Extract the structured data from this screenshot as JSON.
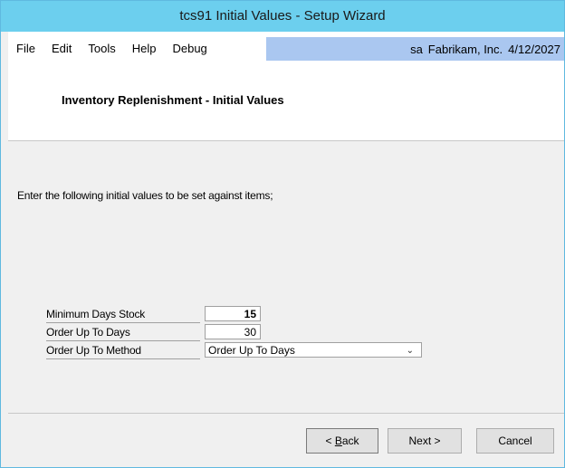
{
  "window": {
    "title": "tcs91 Initial Values - Setup Wizard"
  },
  "menu": {
    "items": [
      "File",
      "Edit",
      "Tools",
      "Help",
      "Debug"
    ]
  },
  "status": {
    "user": "sa",
    "company": "Fabrikam, Inc.",
    "date": "4/12/2027"
  },
  "header": {
    "title": "Inventory Replenishment - Initial Values"
  },
  "body": {
    "instruction": "Enter the following initial values to be set against items;",
    "fields": [
      {
        "label": "Minimum Days Stock",
        "value": "15"
      },
      {
        "label": "Order Up To Days",
        "value": "30"
      },
      {
        "label": "Order Up To Method",
        "value": "Order Up To Days"
      }
    ]
  },
  "buttons": {
    "back_pre": "< ",
    "back_key": "B",
    "back_post": "ack",
    "next": "Next >",
    "cancel": "Cancel"
  },
  "colors": {
    "titlebar": "#6ccfee",
    "status_bg": "#aac7f0"
  }
}
